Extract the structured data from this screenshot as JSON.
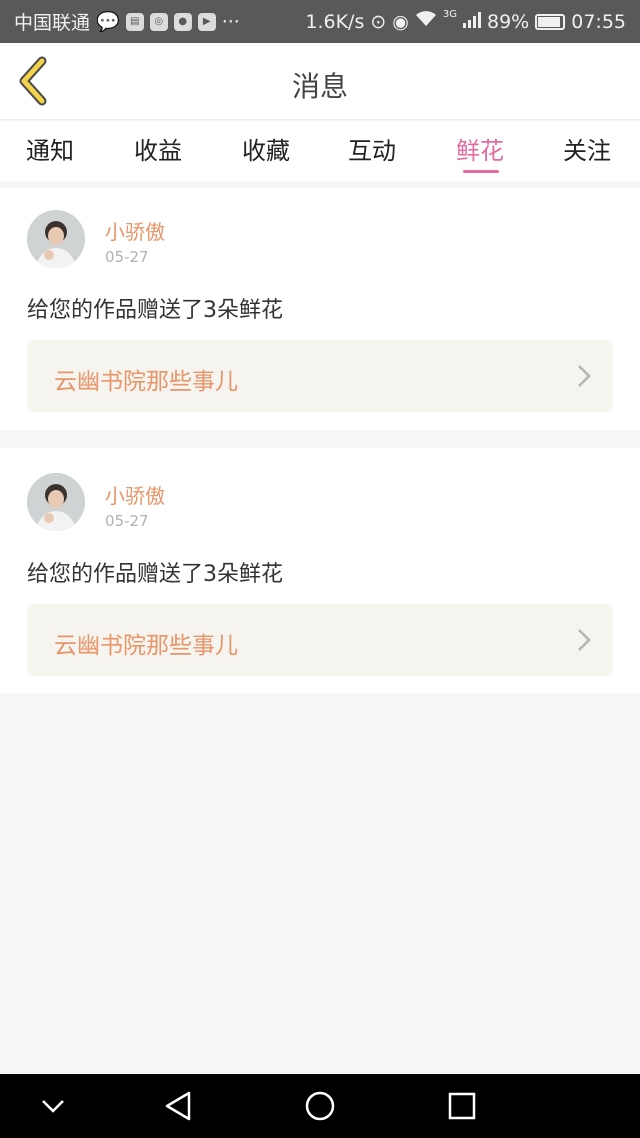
{
  "status_bar": {
    "carrier": "中国联通",
    "speed": "1.6K/s",
    "network": "3G",
    "battery": "89%",
    "time": "07:55",
    "overflow": "···"
  },
  "header": {
    "title": "消息"
  },
  "tabs": [
    {
      "label": "通知",
      "active": false
    },
    {
      "label": "收益",
      "active": false
    },
    {
      "label": "收藏",
      "active": false
    },
    {
      "label": "互动",
      "active": false
    },
    {
      "label": "鲜花",
      "active": true
    },
    {
      "label": "关注",
      "active": false
    }
  ],
  "messages": [
    {
      "user": "小骄傲",
      "date": "05-27",
      "text": "给您的作品赠送了3朵鲜花",
      "work_title": "云幽书院那些事儿"
    },
    {
      "user": "小骄傲",
      "date": "05-27",
      "text": "给您的作品赠送了3朵鲜花",
      "work_title": "云幽书院那些事儿"
    }
  ],
  "colors": {
    "accent": "#e76a9e",
    "username": "#e9956a",
    "back_icon": "#f2d34a"
  }
}
